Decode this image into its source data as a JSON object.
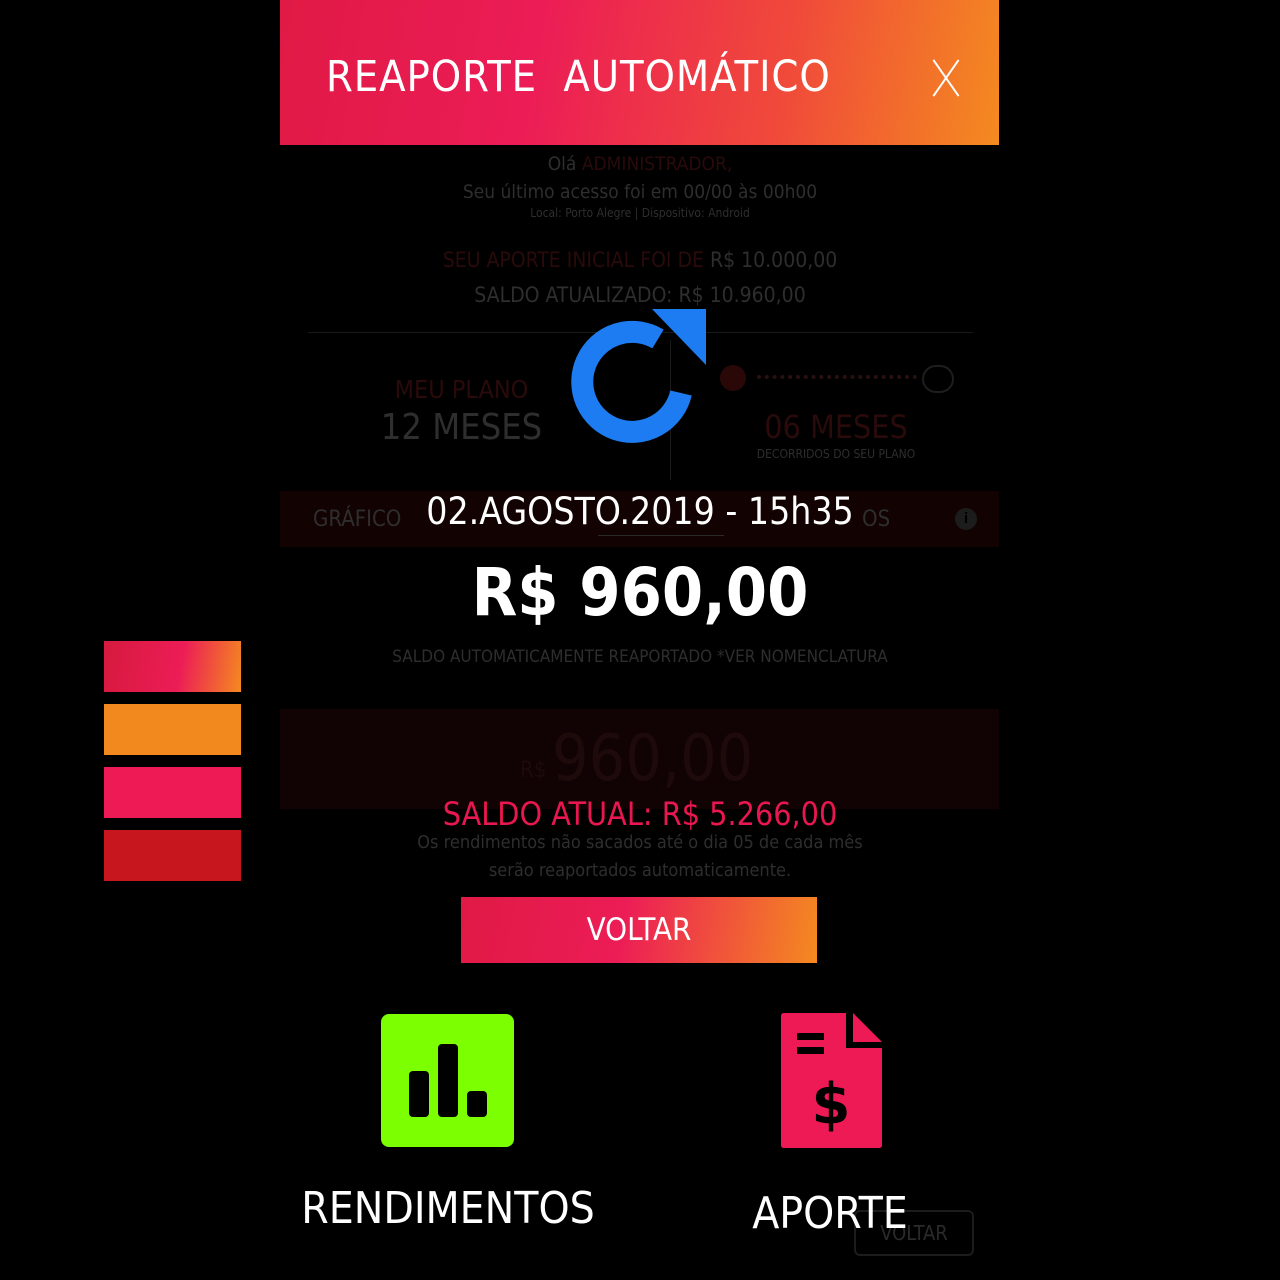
{
  "header": {
    "title": "REAPORTE  AUTOMÁTICO",
    "close_label": "X"
  },
  "background": {
    "greeting_prefix": "Olá ",
    "greeting_user": "ADMINISTRADOR,",
    "last_access": "Seu último acesso foi em 00/00 às 00h00",
    "location": "Local: Porto Alegre | Dispositivo: Android",
    "initial_contribution_label": "SEU APORTE INICIAL FOI DE ",
    "initial_contribution_value": "R$ 10.000,00",
    "updated_balance": "SALDO ATUALIZADO: R$ 10.960,00",
    "plan_label": "MEU PLANO",
    "plan_value": "12 MESES",
    "elapsed_value": "06 MESES",
    "elapsed_label": "DECORRIDOS DO SEU PLANO",
    "tab_left": "GRÁFICO",
    "tab_right": "OS",
    "auto_note": "SALDO AUTOMATICAMENTE REAPORTADO *VER NOMENCLATURA",
    "big_currency": "R$",
    "big_value": "960,00",
    "info_line1": "Os rendimentos não sacados até o dia 05 de cada mês",
    "info_line2": "serão reaportados automaticamente.",
    "ghost_button": "VOLTAR"
  },
  "overlay": {
    "date": "02.AGOSTO.2019 - 15h35",
    "amount": "R$ 960,00",
    "current_balance": "SALDO ATUAL: R$ 5.266,00",
    "back_button": "VOLTAR"
  },
  "swatches": [
    "#e01a45-#f48a20 gradient",
    "#f2891f",
    "#ee1a56",
    "#c8161e"
  ],
  "nav": {
    "rendimentos": "RENDIMENTOS",
    "aporte": "APORTE"
  },
  "icons": {
    "refresh": "refresh-icon",
    "chart": "bar-chart-icon",
    "document": "invoice-dollar-icon",
    "info": "info-icon"
  },
  "colors": {
    "brand_pink": "#ec1c56",
    "brand_orange": "#f48a20",
    "refresh_blue": "#1e7cf2",
    "chart_green": "#7cff00",
    "document_pink": "#ee1a56"
  }
}
